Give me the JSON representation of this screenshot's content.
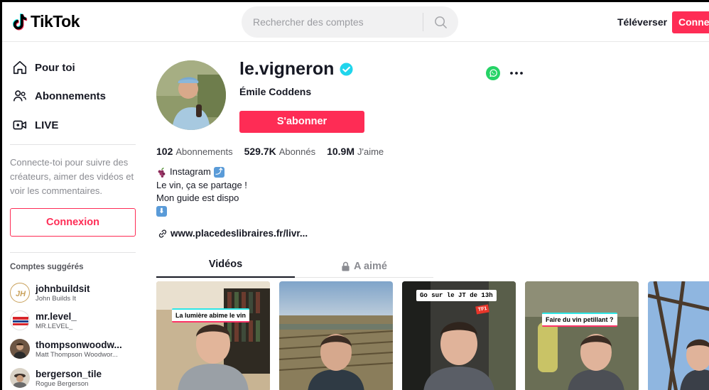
{
  "header": {
    "logo_text": "TikTok",
    "search_placeholder": "Rechercher des comptes",
    "upload_label": "Téléverser",
    "login_label": "Connexion"
  },
  "sidebar": {
    "nav": [
      {
        "label": "Pour toi",
        "icon": "home-icon"
      },
      {
        "label": "Abonnements",
        "icon": "users-icon"
      },
      {
        "label": "LIVE",
        "icon": "live-icon"
      }
    ],
    "login_prompt": "Connecte-toi pour suivre des créateurs, aimer des vidéos et voir les commentaires.",
    "login_button": "Connexion",
    "suggested_title": "Comptes suggérés",
    "suggested": [
      {
        "username": "johnbuildsit",
        "name": "John Builds It"
      },
      {
        "username": "mr.level_",
        "name": "MR.LEVEL_"
      },
      {
        "username": "thompsonwoodw...",
        "name": "Matt Thompson Woodwor..."
      },
      {
        "username": "bergerson_tile",
        "name": "Rogue Bergerson"
      }
    ]
  },
  "profile": {
    "username": "le.vigneron",
    "full_name": "Émile Coddens",
    "follow_label": "S'abonner",
    "stats": [
      {
        "value": "102",
        "label": "Abonnements"
      },
      {
        "value": "529.7K",
        "label": "Abonnés"
      },
      {
        "value": "10.9M",
        "label": "J'aime"
      }
    ],
    "bio": {
      "line1": "Instagram",
      "line2": "Le vin, ça se partage !",
      "line3": "Mon guide est dispo"
    },
    "link": "www.placedeslibraires.fr/livr..."
  },
  "tabs": {
    "videos": "Vidéos",
    "liked": "A aimé"
  },
  "videos": [
    {
      "caption": "La lumière abime le vin"
    },
    {
      "caption": ""
    },
    {
      "caption": "Go sur le JT de 13h",
      "badge": "TF1"
    },
    {
      "caption": "Faire du vin petillant ?"
    },
    {
      "caption": ""
    }
  ],
  "colors": {
    "brand": "#fe2c55",
    "verified": "#20d5ec",
    "whatsapp": "#25d366"
  }
}
